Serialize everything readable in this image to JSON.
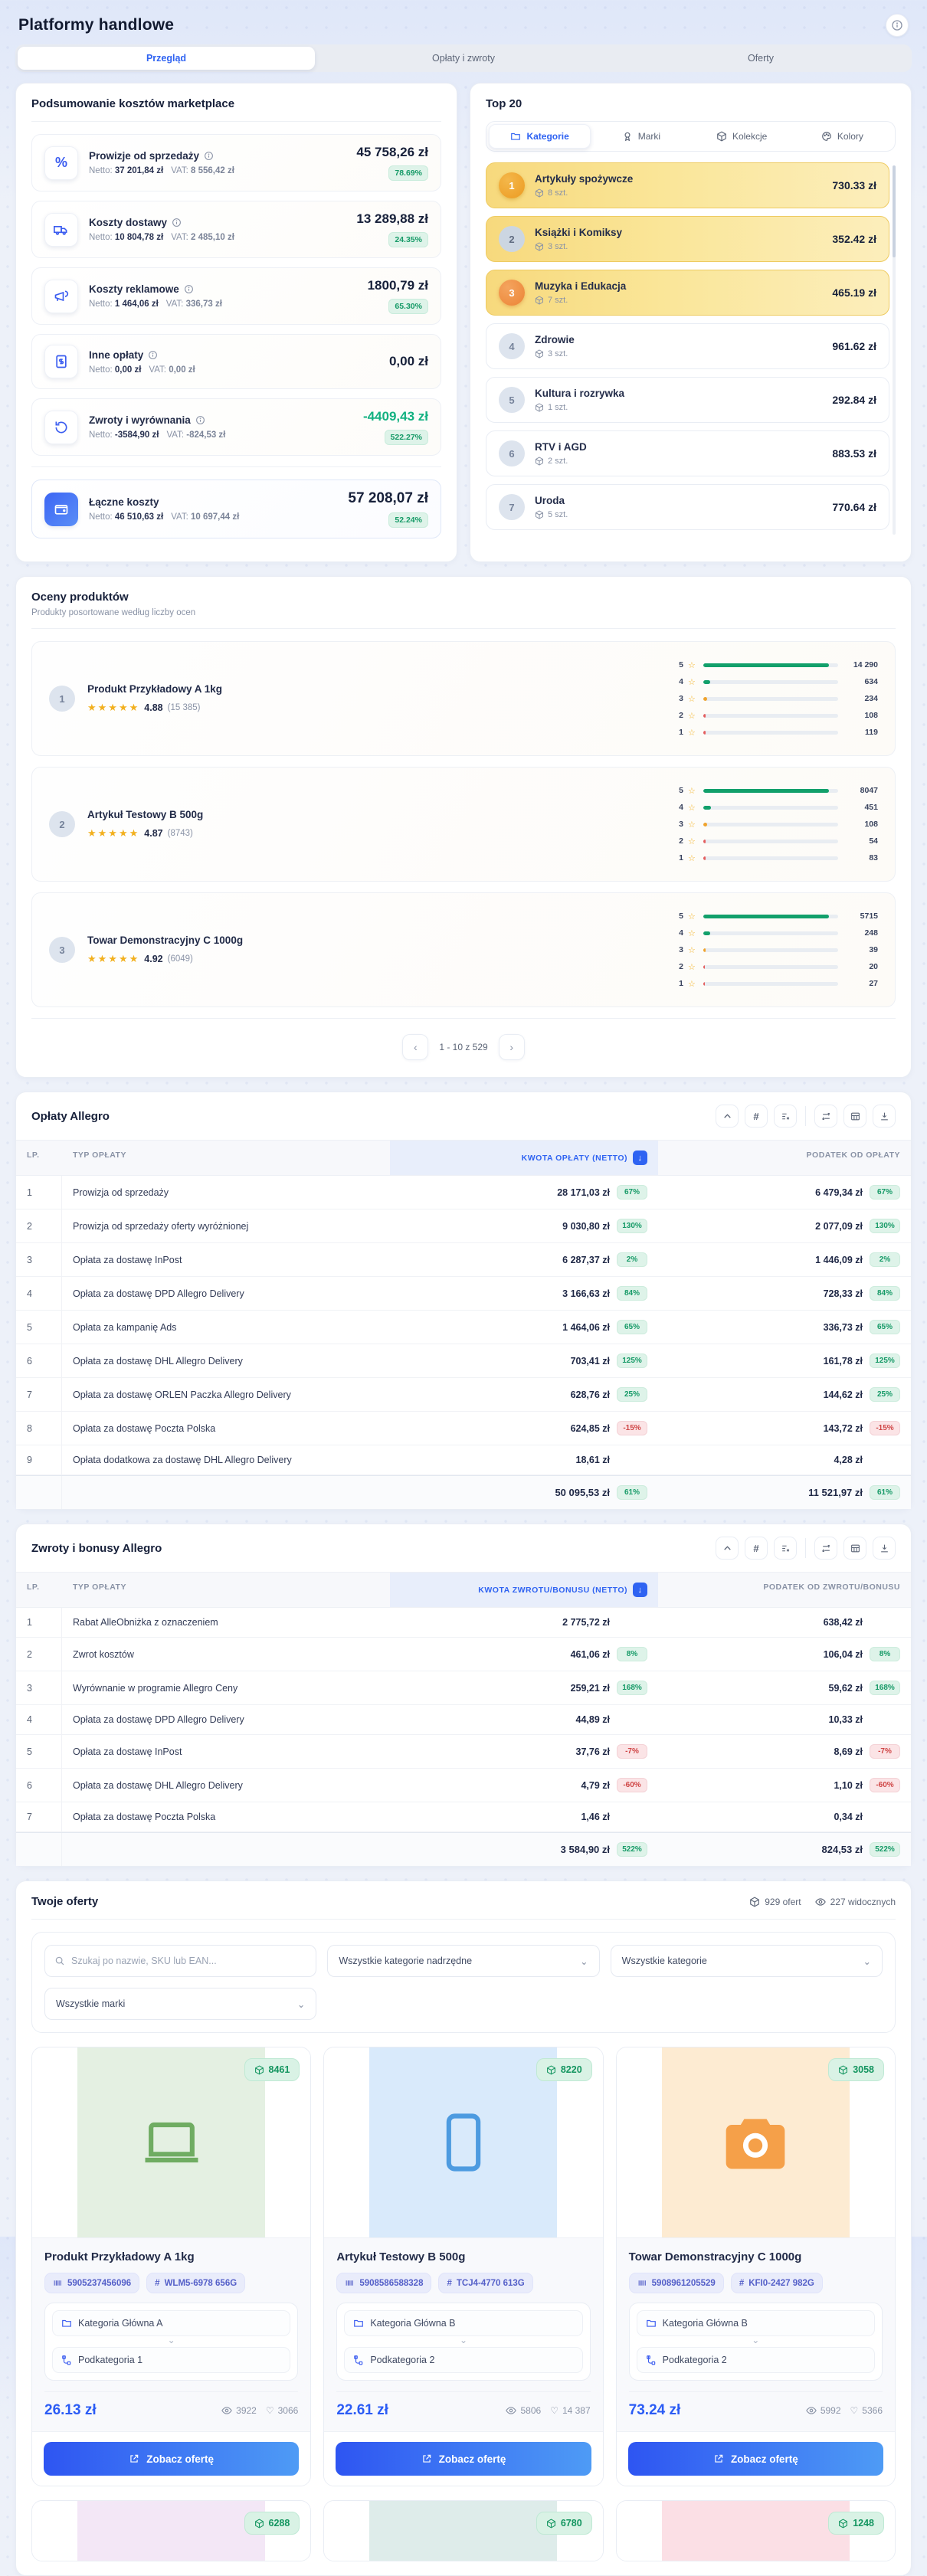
{
  "page": {
    "title": "Platformy handlowe"
  },
  "tabs": {
    "t0": "Przegląd",
    "t1": "Opłaty i zwroty",
    "t2": "Oferty"
  },
  "labels": {
    "netto": "Netto:",
    "vat": "VAT:"
  },
  "summary": {
    "title": "Podsumowanie kosztów marketplace",
    "rows": [
      {
        "icon": "percent",
        "label": "Prowizje od sprzedaży",
        "netto": "37 201,84 zł",
        "vat": "8 556,42 zł",
        "amount": "45 758,26 zł",
        "badge": "78.69%",
        "amount_class": ""
      },
      {
        "icon": "truck",
        "label": "Koszty dostawy",
        "netto": "10 804,78 zł",
        "vat": "2 485,10 zł",
        "amount": "13 289,88 zł",
        "badge": "24.35%",
        "amount_class": ""
      },
      {
        "icon": "megaphone",
        "label": "Koszty reklamowe",
        "netto": "1 464,06 zł",
        "vat": "336,73 zł",
        "amount": "1800,79 zł",
        "badge": "65.30%",
        "amount_class": ""
      },
      {
        "icon": "banknote",
        "label": "Inne opłaty",
        "netto": "0,00 zł",
        "vat": "0,00 zł",
        "amount": "0,00 zł",
        "badge": null,
        "amount_class": ""
      },
      {
        "icon": "refresh",
        "label": "Zwroty i wyrównania",
        "netto": "-3584,90 zł",
        "vat": "-824,53 zł",
        "amount": "-4409,43 zł",
        "badge": "522.27%",
        "amount_class": "green"
      }
    ],
    "total": {
      "label": "Łączne koszty",
      "netto": "46 510,63 zł",
      "vat": "10 697,44 zł",
      "amount": "57 208,07 zł",
      "badge": "52.24%"
    }
  },
  "top20": {
    "title": "Top 20",
    "tabs": {
      "t0": "Kategorie",
      "t1": "Marki",
      "t2": "Kolekcje",
      "t3": "Kolory"
    },
    "items": [
      {
        "rank": "1",
        "rank_class": "r1",
        "row_class": "hl",
        "name": "Artykuły spożywcze",
        "qty": "8 szt.",
        "value": "730.33 zł"
      },
      {
        "rank": "2",
        "rank_class": "r2",
        "row_class": "hl",
        "name": "Książki i Komiksy",
        "qty": "3 szt.",
        "value": "352.42 zł"
      },
      {
        "rank": "3",
        "rank_class": "r3",
        "row_class": "hl",
        "name": "Muzyka i Edukacja",
        "qty": "7 szt.",
        "value": "465.19 zł"
      },
      {
        "rank": "4",
        "rank_class": "rn",
        "row_class": "",
        "name": "Zdrowie",
        "qty": "3 szt.",
        "value": "961.62 zł"
      },
      {
        "rank": "5",
        "rank_class": "rn",
        "row_class": "",
        "name": "Kultura i rozrywka",
        "qty": "1 szt.",
        "value": "292.84 zł"
      },
      {
        "rank": "6",
        "rank_class": "rn",
        "row_class": "",
        "name": "RTV i AGD",
        "qty": "2 szt.",
        "value": "883.53 zł"
      },
      {
        "rank": "7",
        "rank_class": "rn",
        "row_class": "",
        "name": "Uroda",
        "qty": "5 szt.",
        "value": "770.64 zł"
      }
    ]
  },
  "ratings": {
    "title": "Oceny produktów",
    "subtitle": "Produkty posortowane według liczby ocen",
    "stars_glyph": "★★★★★",
    "products": [
      {
        "rank": "1",
        "name": "Produkt Przykładowy A 1kg",
        "rating": "4.88",
        "count": "(15 385)",
        "bars": [
          {
            "star": "5",
            "value": "14 290",
            "pct": 93,
            "color": "g"
          },
          {
            "star": "4",
            "value": "634",
            "pct": 5,
            "color": "g"
          },
          {
            "star": "3",
            "value": "234",
            "pct": 3,
            "color": "o"
          },
          {
            "star": "2",
            "value": "108",
            "pct": 2,
            "color": "r"
          },
          {
            "star": "1",
            "value": "119",
            "pct": 2,
            "color": "r"
          }
        ]
      },
      {
        "rank": "2",
        "name": "Artykuł Testowy B 500g",
        "rating": "4.87",
        "count": "(8743)",
        "bars": [
          {
            "star": "5",
            "value": "8047",
            "pct": 93,
            "color": "g"
          },
          {
            "star": "4",
            "value": "451",
            "pct": 6,
            "color": "g"
          },
          {
            "star": "3",
            "value": "108",
            "pct": 3,
            "color": "o"
          },
          {
            "star": "2",
            "value": "54",
            "pct": 2,
            "color": "r"
          },
          {
            "star": "1",
            "value": "83",
            "pct": 2,
            "color": "r"
          }
        ]
      },
      {
        "rank": "3",
        "name": "Towar Demonstracyjny C 1000g",
        "rating": "4.92",
        "count": "(6049)",
        "bars": [
          {
            "star": "5",
            "value": "5715",
            "pct": 93,
            "color": "g"
          },
          {
            "star": "4",
            "value": "248",
            "pct": 5,
            "color": "g"
          },
          {
            "star": "3",
            "value": "39",
            "pct": 2,
            "color": "o"
          },
          {
            "star": "2",
            "value": "20",
            "pct": 1,
            "color": "r"
          },
          {
            "star": "1",
            "value": "27",
            "pct": 1,
            "color": "r"
          }
        ]
      }
    ],
    "pagination": {
      "label": "1 - 10 z 529",
      "prev": "‹",
      "next": "›"
    }
  },
  "fees_table": {
    "title": "Opłaty Allegro",
    "columns": {
      "lp": "LP.",
      "type": "TYP OPŁATY",
      "amount": "KWOTA OPŁATY (NETTO)",
      "tax": "PODATEK OD OPŁATY"
    },
    "rows": [
      {
        "lp": "1",
        "type": "Prowizja od sprzedaży",
        "amount": "28 171,03 zł",
        "amount_badge": "67%",
        "tax": "6 479,34 zł",
        "tax_badge": "67%",
        "badge_type": "g"
      },
      {
        "lp": "2",
        "type": "Prowizja od sprzedaży oferty wyróżnionej",
        "amount": "9 030,80 zł",
        "amount_badge": "130%",
        "tax": "2 077,09 zł",
        "tax_badge": "130%",
        "badge_type": "g"
      },
      {
        "lp": "3",
        "type": "Opłata za dostawę InPost",
        "amount": "6 287,37 zł",
        "amount_badge": "2%",
        "tax": "1 446,09 zł",
        "tax_badge": "2%",
        "badge_type": "g"
      },
      {
        "lp": "4",
        "type": "Opłata za dostawę DPD Allegro Delivery",
        "amount": "3 166,63 zł",
        "amount_badge": "84%",
        "tax": "728,33 zł",
        "tax_badge": "84%",
        "badge_type": "g"
      },
      {
        "lp": "5",
        "type": "Opłata za kampanię Ads",
        "amount": "1 464,06 zł",
        "amount_badge": "65%",
        "tax": "336,73 zł",
        "tax_badge": "65%",
        "badge_type": "g"
      },
      {
        "lp": "6",
        "type": "Opłata za dostawę DHL Allegro Delivery",
        "amount": "703,41 zł",
        "amount_badge": "125%",
        "tax": "161,78 zł",
        "tax_badge": "125%",
        "badge_type": "g"
      },
      {
        "lp": "7",
        "type": "Opłata za dostawę ORLEN Paczka Allegro Delivery",
        "amount": "628,76 zł",
        "amount_badge": "25%",
        "tax": "144,62 zł",
        "tax_badge": "25%",
        "badge_type": "g"
      },
      {
        "lp": "8",
        "type": "Opłata za dostawę Poczta Polska",
        "amount": "624,85 zł",
        "amount_badge": "-15%",
        "tax": "143,72 zł",
        "tax_badge": "-15%",
        "badge_type": "r"
      },
      {
        "lp": "9",
        "type": "Opłata dodatkowa za dostawę DHL Allegro Delivery",
        "amount": "18,61 zł",
        "amount_badge": null,
        "tax": "4,28 zł",
        "tax_badge": null,
        "badge_type": "g"
      }
    ],
    "total": {
      "amount": "50 095,53 zł",
      "amount_badge": "61%",
      "tax": "11 521,97 zł",
      "tax_badge": "61%"
    }
  },
  "returns_table": {
    "title": "Zwroty i bonusy Allegro",
    "columns": {
      "lp": "LP.",
      "type": "TYP OPŁATY",
      "amount": "KWOTA ZWROTU/BONUSU (NETTO)",
      "tax": "PODATEK OD ZWROTU/BONUSU"
    },
    "rows": [
      {
        "lp": "1",
        "type": "Rabat AlleObniżka z oznaczeniem",
        "amount": "2 775,72 zł",
        "amount_badge": null,
        "tax": "638,42 zł",
        "tax_badge": null,
        "badge_type": "g"
      },
      {
        "lp": "2",
        "type": "Zwrot kosztów",
        "amount": "461,06 zł",
        "amount_badge": "8%",
        "tax": "106,04 zł",
        "tax_badge": "8%",
        "badge_type": "g"
      },
      {
        "lp": "3",
        "type": "Wyrównanie w programie Allegro Ceny",
        "amount": "259,21 zł",
        "amount_badge": "168%",
        "tax": "59,62 zł",
        "tax_badge": "168%",
        "badge_type": "g"
      },
      {
        "lp": "4",
        "type": "Opłata za dostawę DPD Allegro Delivery",
        "amount": "44,89 zł",
        "amount_badge": null,
        "tax": "10,33 zł",
        "tax_badge": null,
        "badge_type": "g"
      },
      {
        "lp": "5",
        "type": "Opłata za dostawę InPost",
        "amount": "37,76 zł",
        "amount_badge": "-7%",
        "tax": "8,69 zł",
        "tax_badge": "-7%",
        "badge_type": "r"
      },
      {
        "lp": "6",
        "type": "Opłata za dostawę DHL Allegro Delivery",
        "amount": "4,79 zł",
        "amount_badge": "-60%",
        "tax": "1,10 zł",
        "tax_badge": "-60%",
        "badge_type": "r"
      },
      {
        "lp": "7",
        "type": "Opłata za dostawę Poczta Polska",
        "amount": "1,46 zł",
        "amount_badge": null,
        "tax": "0,34 zł",
        "tax_badge": null,
        "badge_type": "g"
      }
    ],
    "total": {
      "amount": "3 584,90 zł",
      "amount_badge": "522%",
      "tax": "824,53 zł",
      "tax_badge": "522%"
    }
  },
  "offers": {
    "title": "Twoje oferty",
    "stat_offers": "929 ofert",
    "stat_visible": "227 widocznych",
    "search_placeholder": "Szukaj po nazwie, SKU lub EAN...",
    "filter_parent": "Wszystkie kategorie nadrzędne",
    "filter_category": "Wszystkie kategorie",
    "filter_brand": "Wszystkie marki",
    "view_button": "Zobacz ofertę",
    "cards": [
      {
        "name": "Produkt Przykładowy A 1kg",
        "badge": "8461",
        "icon": "laptop",
        "image_color": "#e4f0e2",
        "icon_color": "#6fac62",
        "ean": "5905237456096",
        "sku": "WLM5-6978 656G",
        "category": "Kategoria Główna A",
        "subcategory": "Podkategoria 1",
        "price": "26.13 zł",
        "views": "3922",
        "likes": "3066"
      },
      {
        "name": "Artykuł Testowy B 500g",
        "badge": "8220",
        "icon": "phone",
        "image_color": "#d9eafb",
        "icon_color": "#4d9be0",
        "ean": "5908586588328",
        "sku": "TCJ4-4770 613G",
        "category": "Kategoria Główna B",
        "subcategory": "Podkategoria 2",
        "price": "22.61 zł",
        "views": "5806",
        "likes": "14 387"
      },
      {
        "name": "Towar Demonstracyjny C 1000g",
        "badge": "3058",
        "icon": "camera",
        "image_color": "#fdebd2",
        "icon_color": "#f5a049",
        "ean": "5908961205529",
        "sku": "KFI0-2427 982G",
        "category": "Kategoria Główna B",
        "subcategory": "Podkategoria 2",
        "price": "73.24 zł",
        "views": "5992",
        "likes": "5366"
      }
    ],
    "partial_cards": [
      {
        "badge": "6288",
        "image_color": "#f3e7f6"
      },
      {
        "badge": "6780",
        "image_color": "#deecea"
      },
      {
        "badge": "1248",
        "image_color": "#fbdfe5"
      }
    ]
  }
}
